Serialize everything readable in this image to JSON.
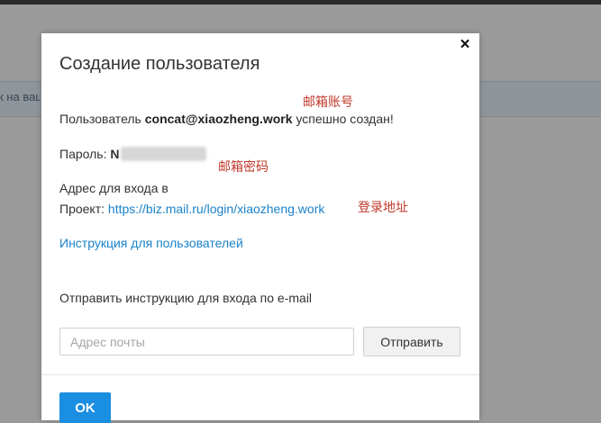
{
  "background": {
    "notice_text": "к на ваш"
  },
  "modal": {
    "title": "Создание пользователя",
    "close_symbol": "×",
    "created": {
      "prefix": "Пользователь",
      "email": "concat@xiaozheng.work",
      "suffix": "успешно создан!"
    },
    "password": {
      "label": "Пароль:",
      "visible_char": "N"
    },
    "login_address": {
      "line1": "Адрес для входа в",
      "line2_prefix": "Проект:",
      "url": "https://biz.mail.ru/login/xiaozheng.work"
    },
    "instructions_link": "Инструкция для пользователей",
    "send_instructions_label": "Отправить инструкцию для входа по e-mail",
    "email_input": {
      "placeholder": "Адрес почты",
      "value": ""
    },
    "send_button": "Отправить",
    "ok_button": "OK"
  },
  "annotations": {
    "email_account": "邮箱账号",
    "email_password": "邮箱密码",
    "login_address": "登录地址"
  },
  "colors": {
    "link": "#1a82c8",
    "primary_button": "#1a8ee0",
    "annotation": "#c0392b",
    "overlay": "#9a9a9a"
  }
}
